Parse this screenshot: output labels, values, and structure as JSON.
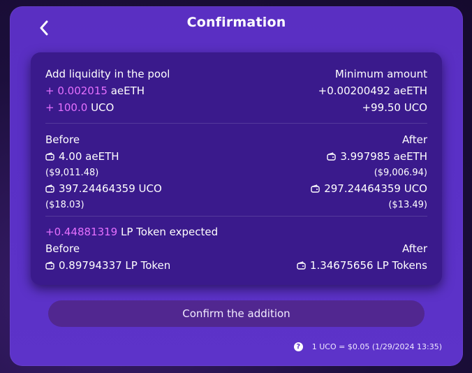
{
  "header": {
    "title": "Confirmation"
  },
  "liquidity": {
    "add_label": "Add liquidity in the pool",
    "minimum_label": "Minimum amount",
    "token1_amount": "+ 0.002015",
    "token1_symbol": "aeETH",
    "token2_amount": "+ 100.0",
    "token2_symbol": "UCO",
    "min_token1": "+0.00200492 aeETH",
    "min_token2": "+99.50 UCO"
  },
  "balances": {
    "before_label": "Before",
    "after_label": "After",
    "before_token1": "4.00 aeETH",
    "before_token1_usd": "($9,011.48)",
    "before_token2": "397.24464359 UCO",
    "before_token2_usd": "($18.03)",
    "after_token1": "3.997985 aeETH",
    "after_token1_usd": "($9,006.94)",
    "after_token2": "297.24464359 UCO",
    "after_token2_usd": "($13.49)"
  },
  "lp": {
    "expected_amount": "+0.44881319",
    "expected_label": "LP Token expected",
    "before_label": "Before",
    "after_label": "After",
    "before_value": "0.89794337 LP Token",
    "after_value": "1.34675656 LP Tokens"
  },
  "actions": {
    "confirm_label": "Confirm the addition"
  },
  "footer": {
    "help_glyph": "?",
    "rate_text": "1 UCO = $0.05 (1/29/2024 13:35)"
  },
  "icons": {
    "back": "chevron-left-icon",
    "wallet": "wallet-icon",
    "help": "help-icon"
  },
  "colors": {
    "accent_pink": "#e570ff",
    "dialog_bg": "#5a30c6",
    "card_bg": "#3a1a8c",
    "button_bg": "#512790"
  }
}
